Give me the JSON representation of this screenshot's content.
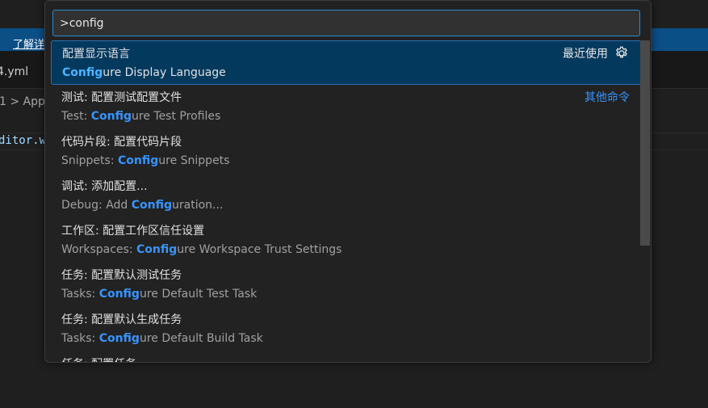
{
  "background": {
    "banner_link": "了解详",
    "tab_name": "4.yml",
    "breadcrumb": "1 > App",
    "code_fragment": "ditor.w"
  },
  "quick_input": {
    "value": ">config",
    "placeholder": "",
    "items": [
      {
        "label": "配置显示语言",
        "detail_prefix": "",
        "detail_match": "Config",
        "detail_suffix": "ure Display Language",
        "right_label": "最近使用",
        "right_icon": "gear-icon"
      },
      {
        "label": "测试: 配置测试配置文件",
        "detail_prefix": "Test: ",
        "detail_match": "Config",
        "detail_suffix": "ure Test Profiles",
        "right_label": "其他命令"
      },
      {
        "label": "代码片段: 配置代码片段",
        "detail_prefix": "Snippets: ",
        "detail_match": "Config",
        "detail_suffix": "ure Snippets"
      },
      {
        "label": "调试: 添加配置...",
        "detail_prefix": "Debug: Add ",
        "detail_match": "Config",
        "detail_suffix": "uration..."
      },
      {
        "label": "工作区: 配置工作区信任设置",
        "detail_prefix": "Workspaces: ",
        "detail_match": "Config",
        "detail_suffix": "ure Workspace Trust Settings"
      },
      {
        "label": "任务: 配置默认测试任务",
        "detail_prefix": "Tasks: ",
        "detail_match": "Config",
        "detail_suffix": "ure Default Test Task"
      },
      {
        "label": "任务: 配置默认生成任务",
        "detail_prefix": "Tasks: ",
        "detail_match": "Config",
        "detail_suffix": "ure Default Build Task"
      },
      {
        "label": "任务: 配置任务",
        "detail_prefix": "",
        "detail_match": "",
        "detail_suffix": ""
      }
    ]
  },
  "colors": {
    "accent": "#3794ff",
    "selection_bg": "#04395e",
    "panel_bg": "#222222"
  }
}
